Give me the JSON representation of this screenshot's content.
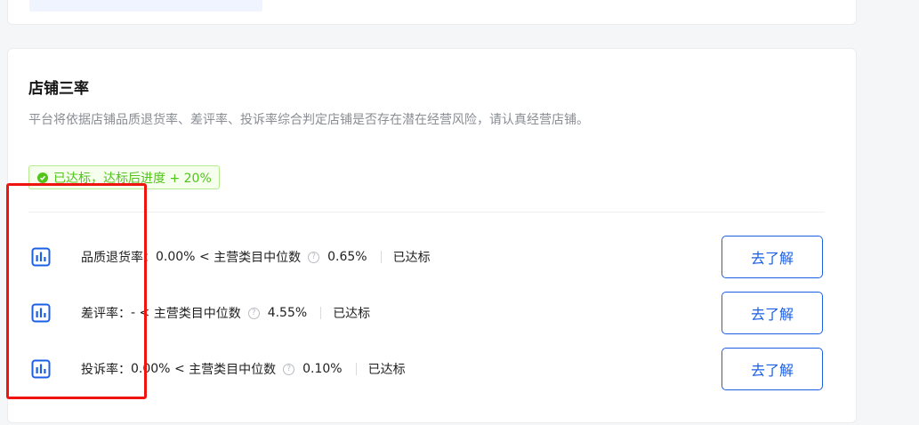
{
  "store_rates": {
    "title": "店铺三率",
    "description": "平台将依据店铺品质退货率、差评率、投诉率综合判定店铺是否存在潜在经营风险，请认真经营店铺。",
    "status_tag": "已达标，达标后进度 + 20%",
    "metrics": [
      {
        "name": "品质退货率",
        "value": "0.00%",
        "comparator": "<",
        "benchmark_label": "主营类目中位数",
        "benchmark_value": "0.65%",
        "status": "已达标",
        "button": "去了解"
      },
      {
        "name": "差评率",
        "value": "-",
        "comparator": "<",
        "benchmark_label": "主营类目中位数",
        "benchmark_value": "4.55%",
        "status": "已达标",
        "button": "去了解"
      },
      {
        "name": "投诉率",
        "value": "0.00%",
        "comparator": "<",
        "benchmark_label": "主营类目中位数",
        "benchmark_value": "0.10%",
        "status": "已达标",
        "button": "去了解"
      }
    ]
  },
  "colors": {
    "accent_blue": "#1b5fe6",
    "success_green": "#52c41a",
    "highlight_red": "#f0140e"
  },
  "icons": {
    "metric": "bar-chart-icon",
    "tag": "check-circle-icon",
    "help": "question-circle-icon"
  }
}
